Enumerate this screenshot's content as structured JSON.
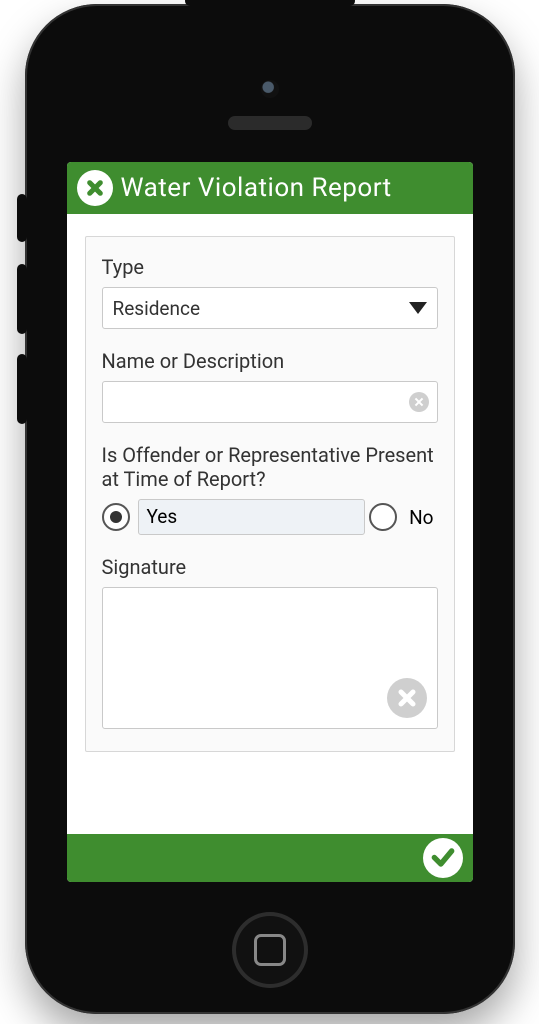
{
  "colors": {
    "brand": "#3f8d2f"
  },
  "header": {
    "title": "Water Violation Report",
    "close_icon": "close-icon",
    "menu_icon": "menu-icon"
  },
  "form": {
    "type": {
      "label": "Type",
      "selected": "Residence"
    },
    "name": {
      "label": "Name or Description",
      "value": "",
      "placeholder": ""
    },
    "presence": {
      "label": "Is Offender or Representative Present at Time of Report?",
      "options": {
        "yes": "Yes",
        "no": "No"
      },
      "selected": "yes"
    },
    "signature": {
      "label": "Signature"
    }
  },
  "footer": {
    "submit_icon": "check-icon"
  }
}
